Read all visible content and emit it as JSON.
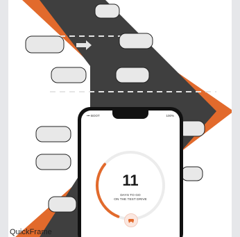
{
  "brand": {
    "name": "QuickFrame"
  },
  "colors": {
    "accent": "#e26a2c",
    "road": "#3f3f3f",
    "screen": "#ffffff"
  },
  "phone": {
    "status_left": "••• BOOT",
    "status_right": "100%",
    "countdown": "11",
    "caption_line1": "DAYS TO GO",
    "caption_line2": "ON THE TEST DRIVE",
    "progress": 0.3,
    "icon": "car-icon"
  }
}
